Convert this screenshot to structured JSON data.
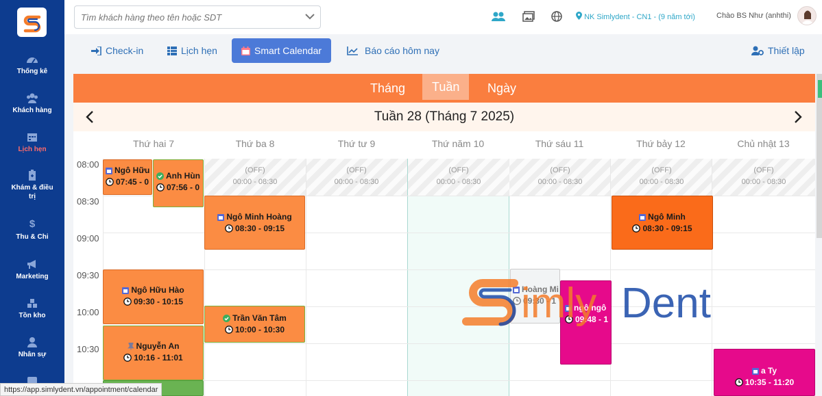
{
  "sidebar": {
    "items": [
      {
        "label": "Thống kê",
        "icon": "dashboard-icon",
        "active": false
      },
      {
        "label": "Khách hàng",
        "icon": "users-icon",
        "active": false
      },
      {
        "label": "Lịch hẹn",
        "icon": "calendar-icon",
        "active": true
      },
      {
        "label": "Khám & điều trị",
        "icon": "clipboard-icon",
        "active": false
      },
      {
        "label": "Thu & Chi",
        "icon": "dollar-icon",
        "active": false
      },
      {
        "label": "Marketing",
        "icon": "megaphone-icon",
        "active": false
      },
      {
        "label": "Tồn kho",
        "icon": "warehouse-icon",
        "active": false
      },
      {
        "label": "Nhân sự",
        "icon": "staff-icon",
        "active": false
      }
    ]
  },
  "topbar": {
    "search_placeholder": "Tìm khách hàng theo tên hoặc SDT",
    "branch": "NK Simlydent - CN1 - (9 năm tới)",
    "greeting": "Chào BS Như (anhthi)"
  },
  "toolbar": {
    "checkin": "Check-in",
    "schedule": "Lịch hẹn",
    "smart_calendar": "Smart Calendar",
    "report_today": "Báo cáo hôm nay",
    "settings": "Thiết lập"
  },
  "calendar": {
    "views": [
      "Tháng",
      "Tuần",
      "Ngày"
    ],
    "active_view": "Tuần",
    "week_title": "Tuần 28 (Tháng 7 2025)",
    "days": [
      "Thứ hai 7",
      "Thứ ba 8",
      "Thứ tư 9",
      "Thứ năm 10",
      "Thứ sáu 11",
      "Thứ bảy 12",
      "Chủ nhật 13"
    ],
    "times": [
      "08:00",
      "08:30",
      "09:00",
      "09:30",
      "10:00",
      "10:30"
    ],
    "off_label": "(OFF)",
    "off_time": "00:00 - 08:30",
    "appointments": [
      {
        "name": "Ngô Hữu",
        "time": "07:45 - 0",
        "status": "booked"
      },
      {
        "name": "Anh Hùn",
        "time": "07:56 - 0",
        "status": "checked"
      },
      {
        "name": "Ngô Minh Hoàng",
        "time": "08:30 - 09:15",
        "status": "booked"
      },
      {
        "name": "Ngô Minh",
        "time": "08:30 - 09:15",
        "status": "booked"
      },
      {
        "name": "Ngô Hữu Hào",
        "time": "09:30 - 10:15",
        "status": "booked"
      },
      {
        "name": "Hoàng Mi",
        "time": "09:30 - 1",
        "status": "booked"
      },
      {
        "name": "Trần Văn Tâm",
        "time": "10:00 - 10:30",
        "status": "checked"
      },
      {
        "name": "ngô ngô",
        "time": "09:48 - 1",
        "status": "booked"
      },
      {
        "name": "Nguyễn An",
        "time": "10:16 - 11:01",
        "status": "pinned"
      },
      {
        "name": "a Ty",
        "time": "10:35 - 11:20",
        "status": "booked"
      }
    ]
  },
  "watermark": {
    "part1": "imly",
    "part2": "Dent"
  },
  "status_url": "https://app.simlydent.vn/appointment/calendar",
  "colors": {
    "sidebar": "#0d3c8f",
    "orange": "#fa7e3f",
    "pink": "#e60a8b",
    "primary": "#4c7ad8"
  }
}
